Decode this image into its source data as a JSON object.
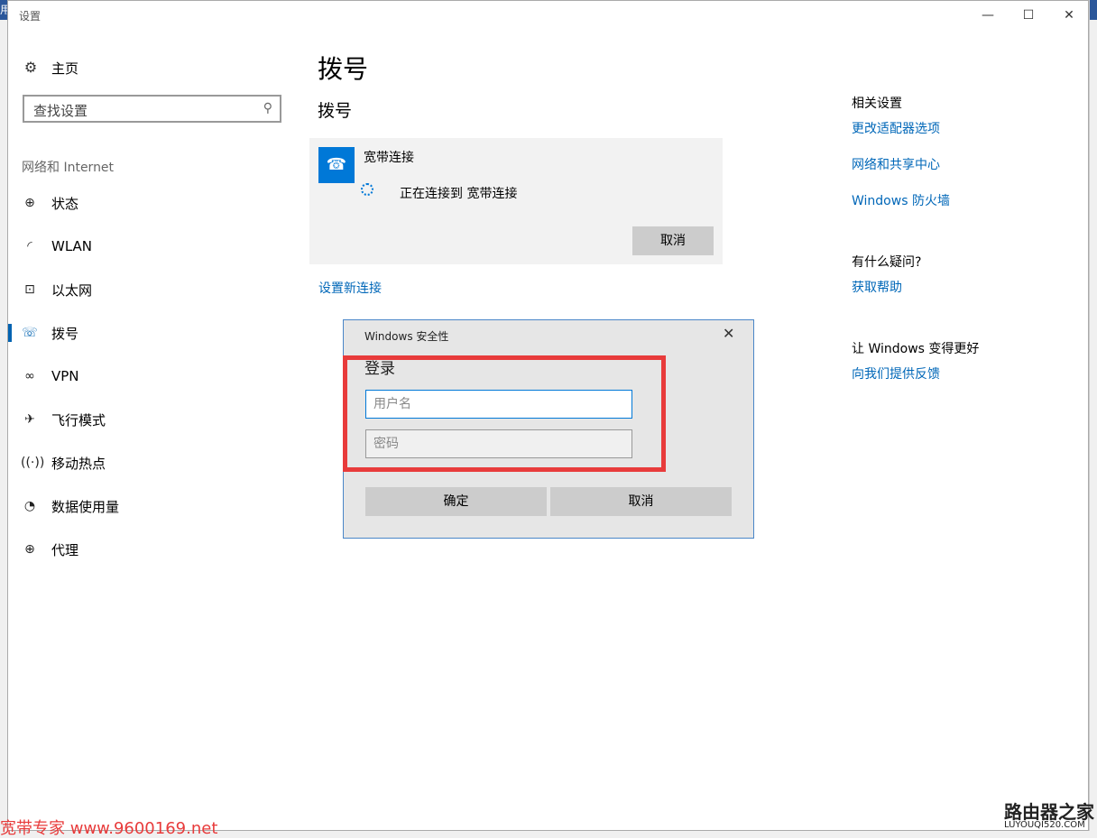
{
  "window": {
    "title": "设置"
  },
  "sidebar": {
    "home_label": "主页",
    "search_placeholder": "查找设置",
    "section_label": "网络和 Internet",
    "items": [
      {
        "label": "状态",
        "icon": "globe-icon"
      },
      {
        "label": "WLAN",
        "icon": "wifi-icon"
      },
      {
        "label": "以太网",
        "icon": "ethernet-icon"
      },
      {
        "label": "拨号",
        "icon": "phone-icon",
        "selected": true
      },
      {
        "label": "VPN",
        "icon": "vpn-icon"
      },
      {
        "label": "飞行模式",
        "icon": "airplane-icon"
      },
      {
        "label": "移动热点",
        "icon": "hotspot-icon"
      },
      {
        "label": "数据使用量",
        "icon": "data-usage-icon"
      },
      {
        "label": "代理",
        "icon": "proxy-icon"
      }
    ]
  },
  "main": {
    "title": "拨号",
    "subtitle": "拨号",
    "connection": {
      "name": "宽带连接",
      "status": "正在连接到 宽带连接",
      "cancel_label": "取消"
    },
    "new_connection_link": "设置新连接"
  },
  "right": {
    "related_heading": "相关设置",
    "links": [
      "更改适配器选项",
      "网络和共享中心",
      "Windows 防火墙"
    ],
    "question_heading": "有什么疑问?",
    "help_link": "获取帮助",
    "improve_heading": "让 Windows 变得更好",
    "feedback_link": "向我们提供反馈"
  },
  "dialog": {
    "title": "Windows 安全性",
    "heading": "登录",
    "username_placeholder": "用户名",
    "password_placeholder": "密码",
    "ok_label": "确定",
    "cancel_label": "取消"
  },
  "watermarks": {
    "left": "宽带专家 www.9600169.net",
    "right_main": "路由器之家",
    "right_sub": "LUYOUQI520.COM"
  },
  "colors": {
    "accent": "#0078d7",
    "link": "#0067b8",
    "highlight": "#e83b3b"
  }
}
